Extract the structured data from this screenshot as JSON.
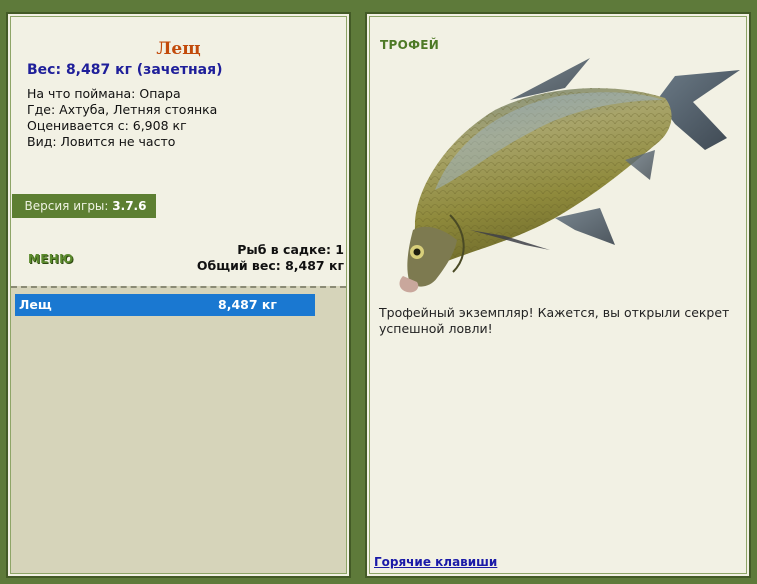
{
  "left": {
    "title": "Лещ",
    "weight": "Вес: 8,487 кг (зачетная)",
    "info": [
      "На что поймана: Опара",
      "Где: Ахтуба, Летняя стоянка",
      "Оценивается с: 6,908 кг",
      "Вид: Ловится не часто"
    ],
    "version_label": "Версия игры:",
    "version_value": "3.7.6",
    "menu": "МЕНЮ",
    "fish_count": "Рыб в садке: 1",
    "total_weight": "Общий вес: 8,487 кг",
    "catch_list": [
      {
        "name": "Лещ",
        "weight": "8,487 кг"
      }
    ]
  },
  "right": {
    "badge": "ТРОФЕЙ",
    "fish_image": "bream-fish-image",
    "description": "Трофейный экземпляр! Кажется, вы открыли секрет успешной ловли!",
    "hotkeys": "Горячие клавиши"
  },
  "colors": {
    "background": "#5e7a3a",
    "panel": "#f2f1e4",
    "title": "#c24a0a",
    "weight": "#1f1f9a",
    "selection": "#1a78d1",
    "version_bar": "#5d7f32",
    "list_area": "#d6d4ba"
  }
}
